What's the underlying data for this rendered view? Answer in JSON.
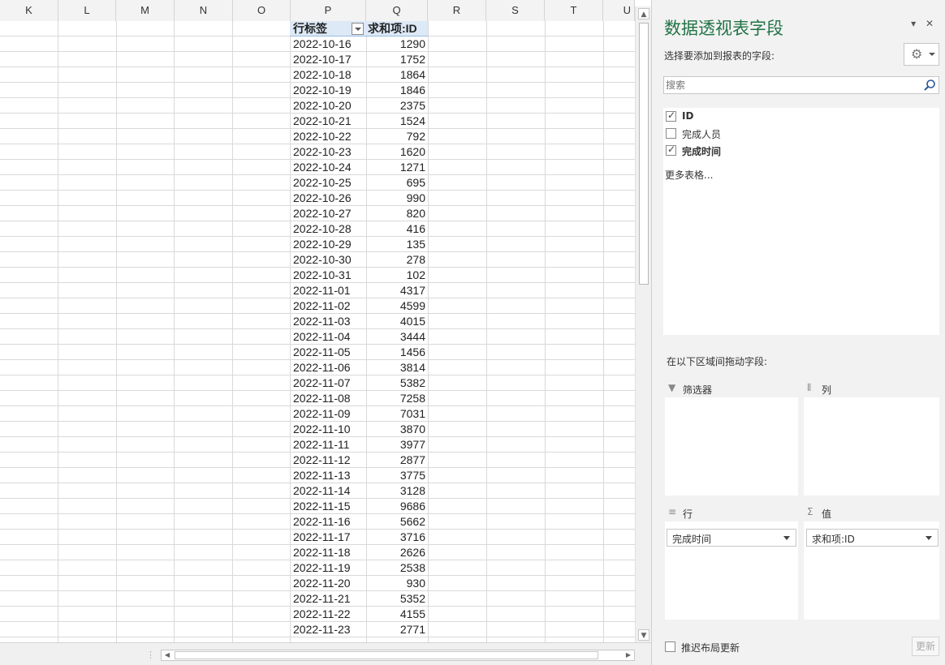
{
  "sheet": {
    "columns": [
      "K",
      "L",
      "M",
      "N",
      "O",
      "P",
      "Q",
      "R",
      "S",
      "T",
      "U"
    ],
    "pivot": {
      "header_row_label": "行标签",
      "header_value_label": "求和项:ID",
      "rows": [
        [
          "2022-10-16",
          "1290"
        ],
        [
          "2022-10-17",
          "1752"
        ],
        [
          "2022-10-18",
          "1864"
        ],
        [
          "2022-10-19",
          "1846"
        ],
        [
          "2022-10-20",
          "2375"
        ],
        [
          "2022-10-21",
          "1524"
        ],
        [
          "2022-10-22",
          "792"
        ],
        [
          "2022-10-23",
          "1620"
        ],
        [
          "2022-10-24",
          "1271"
        ],
        [
          "2022-10-25",
          "695"
        ],
        [
          "2022-10-26",
          "990"
        ],
        [
          "2022-10-27",
          "820"
        ],
        [
          "2022-10-28",
          "416"
        ],
        [
          "2022-10-29",
          "135"
        ],
        [
          "2022-10-30",
          "278"
        ],
        [
          "2022-10-31",
          "102"
        ],
        [
          "2022-11-01",
          "4317"
        ],
        [
          "2022-11-02",
          "4599"
        ],
        [
          "2022-11-03",
          "4015"
        ],
        [
          "2022-11-04",
          "3444"
        ],
        [
          "2022-11-05",
          "1456"
        ],
        [
          "2022-11-06",
          "3814"
        ],
        [
          "2022-11-07",
          "5382"
        ],
        [
          "2022-11-08",
          "7258"
        ],
        [
          "2022-11-09",
          "7031"
        ],
        [
          "2022-11-10",
          "3870"
        ],
        [
          "2022-11-11",
          "3977"
        ],
        [
          "2022-11-12",
          "2877"
        ],
        [
          "2022-11-13",
          "3775"
        ],
        [
          "2022-11-14",
          "3128"
        ],
        [
          "2022-11-15",
          "9686"
        ],
        [
          "2022-11-16",
          "5662"
        ],
        [
          "2022-11-17",
          "3716"
        ],
        [
          "2022-11-18",
          "2626"
        ],
        [
          "2022-11-19",
          "2538"
        ],
        [
          "2022-11-20",
          "930"
        ],
        [
          "2022-11-21",
          "5352"
        ],
        [
          "2022-11-22",
          "4155"
        ],
        [
          "2022-11-23",
          "2771"
        ]
      ]
    }
  },
  "panel": {
    "title": "数据透视表字段",
    "choose_label": "选择要添加到报表的字段:",
    "search_placeholder": "搜索",
    "fields": [
      {
        "label": "ID",
        "checked": true,
        "bold": true
      },
      {
        "label": "完成人员",
        "checked": false,
        "bold": false
      },
      {
        "label": "完成时间",
        "checked": true,
        "bold": true
      }
    ],
    "more_tables": "更多表格...",
    "drag_label": "在以下区域间拖动字段:",
    "zones": {
      "filters": "筛选器",
      "columns": "列",
      "rows": "行",
      "values": "值",
      "rows_field": "完成时间",
      "values_field": "求和项:ID"
    },
    "defer_label": "推迟布局更新",
    "update_label": "更新"
  },
  "colors": {
    "accent": "#217346",
    "pivot_header_bg": "#dde9f7"
  }
}
